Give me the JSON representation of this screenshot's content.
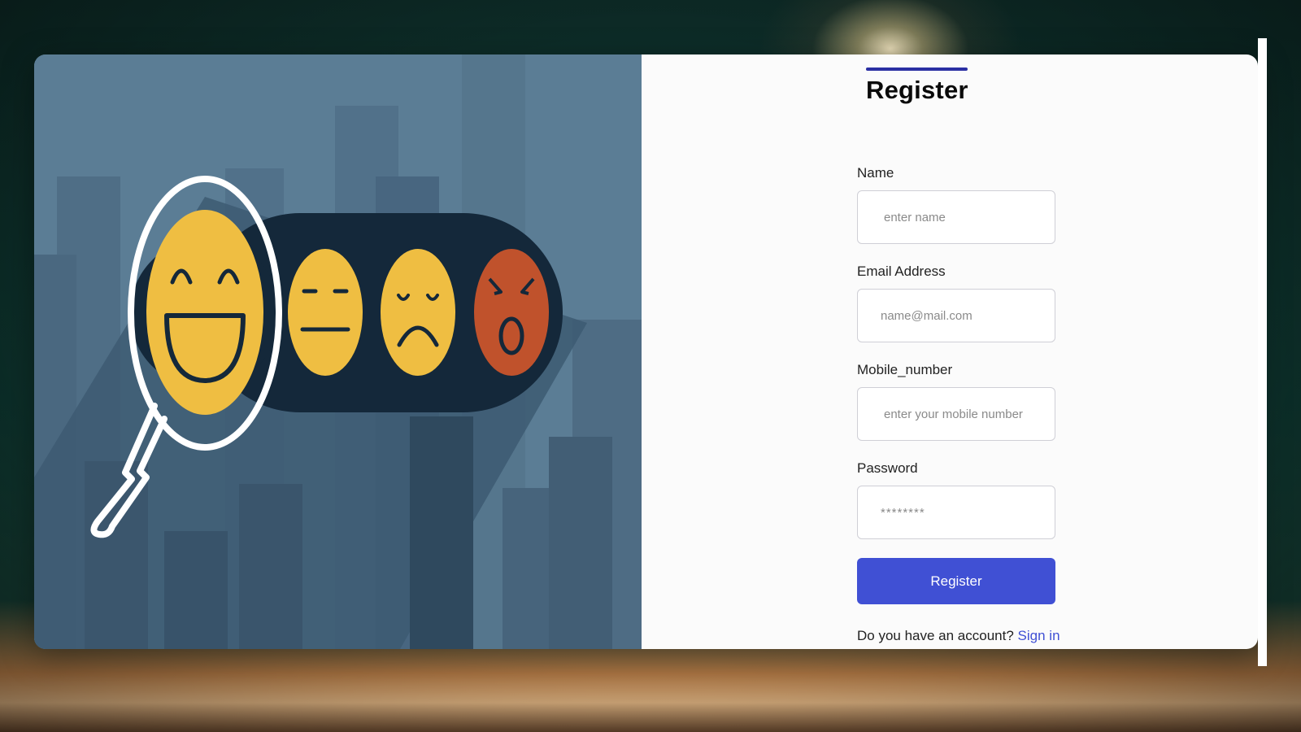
{
  "form": {
    "title": "Register",
    "fields": [
      {
        "label": "Name",
        "placeholder": "enter name"
      },
      {
        "label": "Email Address",
        "placeholder": "name@mail.com"
      },
      {
        "label": "Mobile_number",
        "placeholder": "enter your mobile number"
      },
      {
        "label": "Password",
        "placeholder": "********"
      }
    ],
    "submit_label": "Register",
    "account_prompt": "Do you have an account?",
    "signin_label": "Sign in"
  },
  "illustration": {
    "faces": [
      "happy-face-icon",
      "neutral-face-icon",
      "sad-face-icon",
      "angry-face-icon"
    ],
    "tool": "magnifying-glass-icon"
  },
  "colors": {
    "accent": "#4050d4",
    "title_underline": "#2a2fa3",
    "face_yellow": "#efbe42",
    "face_red": "#c0522c",
    "panel_blue": "#5b7d95",
    "pill_dark": "#14283a"
  }
}
